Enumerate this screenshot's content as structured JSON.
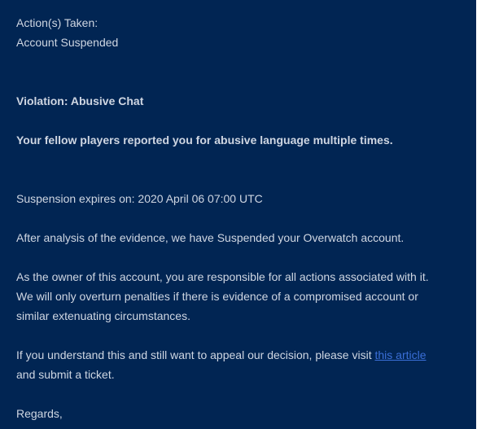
{
  "message": {
    "actions_label": "Action(s) Taken:",
    "action_value": "Account Suspended",
    "violation": "Violation: Abusive Chat",
    "report_summary": "Your fellow players reported you for abusive language multiple times.",
    "expiry": "Suspension expires on: 2020 April 06 07:00 UTC",
    "analysis": "After analysis of the evidence, we have Suspended your Overwatch account.",
    "owner_line_1": "As the owner of this account, you are responsible for all actions associated with it.",
    "owner_line_2": "We will only overturn penalties if there is evidence of a compromised account or",
    "owner_line_3": "similar extenuating circumstances.",
    "appeal_prefix": "If you understand this and still want to appeal our decision, please visit ",
    "appeal_link": "this article",
    "appeal_suffix": "and submit a ticket.",
    "regards": "Regards,"
  },
  "colors": {
    "panel_background": "#012553",
    "text": "#cfd6e2",
    "link": "#3a6fd8"
  }
}
